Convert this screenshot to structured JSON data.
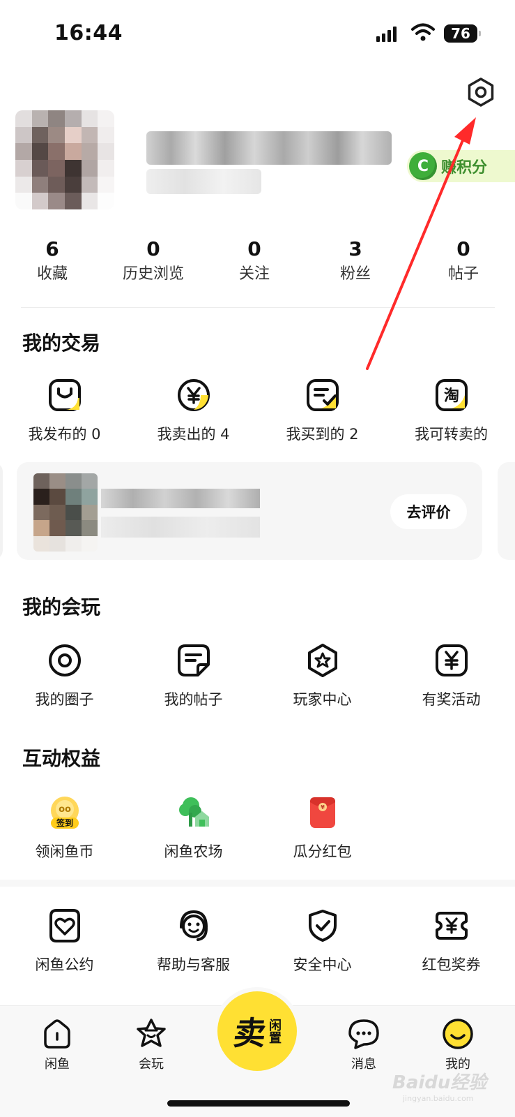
{
  "status_bar": {
    "time": "16:44",
    "battery": "76"
  },
  "profile": {
    "points_label": "赚积分",
    "coin_glyph": "C"
  },
  "stats": [
    {
      "value": "6",
      "label": "收藏"
    },
    {
      "value": "0",
      "label": "历史浏览"
    },
    {
      "value": "0",
      "label": "关注"
    },
    {
      "value": "3",
      "label": "粉丝"
    },
    {
      "value": "0",
      "label": "帖子"
    }
  ],
  "trade": {
    "title": "我的交易",
    "items": [
      {
        "label": "我发布的 0",
        "icon": "bag-icon"
      },
      {
        "label": "我卖出的 4",
        "icon": "yen-circle-icon"
      },
      {
        "label": "我买到的 2",
        "icon": "checklist-icon"
      },
      {
        "label": "我可转卖的",
        "icon": "taobao-icon"
      }
    ],
    "review_button": "去评价"
  },
  "play": {
    "title": "我的会玩",
    "items": [
      {
        "label": "我的圈子",
        "icon": "circle-icon"
      },
      {
        "label": "我的帖子",
        "icon": "post-icon"
      },
      {
        "label": "玩家中心",
        "icon": "star-badge-icon"
      },
      {
        "label": "有奖活动",
        "icon": "yen-ticket-icon"
      }
    ]
  },
  "benefits": {
    "title": "互动权益",
    "checkin_badge": "签到",
    "items": [
      {
        "label": "领闲鱼币",
        "icon": "checkin-coin-icon"
      },
      {
        "label": "闲鱼农场",
        "icon": "farm-icon"
      },
      {
        "label": "瓜分红包",
        "icon": "red-packet-icon"
      }
    ]
  },
  "services": {
    "items": [
      {
        "label": "闲鱼公约",
        "icon": "heart-shield-icon"
      },
      {
        "label": "帮助与客服",
        "icon": "headset-icon"
      },
      {
        "label": "安全中心",
        "icon": "shield-check-icon"
      },
      {
        "label": "红包奖券",
        "icon": "coupon-icon"
      }
    ]
  },
  "tabbar": {
    "items": [
      {
        "label": "闲鱼",
        "icon": "home-icon"
      },
      {
        "label": "会玩",
        "icon": "star-face-icon"
      },
      {
        "label": "消息",
        "icon": "message-icon"
      },
      {
        "label": "我的",
        "icon": "smile-avatar-icon"
      }
    ],
    "sell_big": "卖",
    "sell_small": "闲置"
  },
  "watermark": {
    "brand": "Baidu经验",
    "url": "jingyan.baidu.com"
  },
  "colors": {
    "accent": "#ffe033",
    "annotation": "#ff2a2a",
    "points_bg": "#eef9cf",
    "coin": "#3fae3a"
  }
}
